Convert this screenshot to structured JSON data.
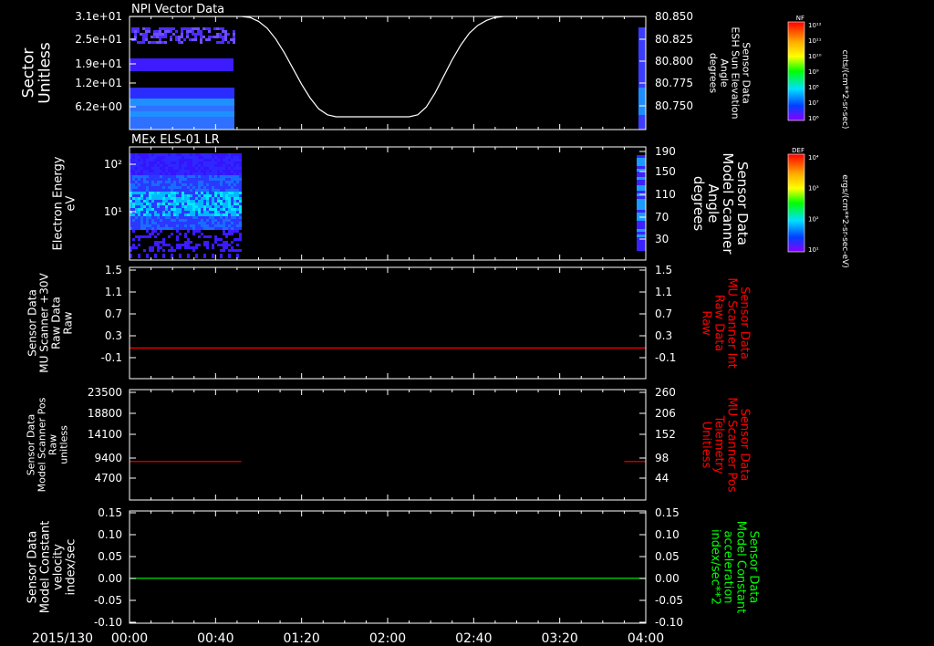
{
  "footer": {
    "date_label": "2015/130"
  },
  "x_ticks": [
    "00:00",
    "00:40",
    "01:20",
    "02:00",
    "02:40",
    "03:20",
    "04:00"
  ],
  "chart_data": [
    {
      "type": "heatmap",
      "title": "NPI Vector Data",
      "left_axis": {
        "labels": [
          "Sector",
          "Unitless"
        ],
        "ticks": [
          "3.1e+01",
          "2.5e+01",
          "1.9e+01",
          "1.2e+01",
          "6.2e+00"
        ]
      },
      "right_axis": {
        "labels": [
          "Sensor Data",
          "ESH Sun Elevation",
          "Angle",
          "degrees"
        ],
        "ticks": [
          "80.850",
          "80.825",
          "80.800",
          "80.775",
          "80.750"
        ],
        "ylim": [
          80.735,
          80.85
        ]
      },
      "line": {
        "color": "#ffffff",
        "x": [
          "00:00",
          "00:52",
          "00:56",
          "01:00",
          "01:04",
          "01:08",
          "01:12",
          "01:16",
          "01:20",
          "01:24",
          "01:28",
          "01:32",
          "01:36",
          "01:40",
          "01:44",
          "02:10",
          "02:14",
          "02:18",
          "02:22",
          "02:26",
          "02:30",
          "02:34",
          "02:38",
          "02:42",
          "02:46",
          "02:50",
          "02:54",
          "03:00",
          "04:00"
        ],
        "y": [
          80.85,
          80.85,
          80.849,
          80.845,
          80.838,
          80.827,
          80.813,
          80.797,
          80.781,
          80.767,
          80.756,
          80.75,
          80.748,
          80.748,
          80.748,
          80.748,
          80.75,
          80.758,
          80.772,
          80.789,
          80.806,
          80.821,
          80.833,
          80.841,
          80.846,
          80.849,
          80.85,
          80.85,
          80.85
        ]
      },
      "colorbar": {
        "label": "NF",
        "units": "cnts/(cm**2-sr-sec)",
        "ticks": [
          "10¹²",
          "10¹¹",
          "10¹⁰",
          "10⁹",
          "10⁸",
          "10⁷",
          "10⁶"
        ]
      }
    },
    {
      "type": "heatmap",
      "title": "MEx ELS-01 LR",
      "left_axis": {
        "labels": [
          "Electron Energy",
          "eV"
        ],
        "ticks": [
          "10²",
          "10¹"
        ]
      },
      "right_axis": {
        "labels": [
          "Sensor Data",
          "Model Scanner",
          "Angle",
          "degrees"
        ],
        "ticks": [
          "190",
          "150",
          "110",
          "70",
          "30"
        ],
        "ylim": [
          10,
          190
        ]
      },
      "colorbar": {
        "label": "DEF",
        "units": "ergs/(cm**2-sr-sec-eV)",
        "ticks": [
          "10⁴",
          "10³",
          "10²",
          "10¹"
        ]
      }
    },
    {
      "type": "line",
      "left_axis": {
        "labels": [
          "Sensor Data",
          "MU Scanner +30V",
          "Raw Data",
          "Raw"
        ],
        "ticks": [
          "1.5",
          "1.1",
          "0.7",
          "0.3",
          "-0.1"
        ],
        "ylim": [
          -0.5,
          1.5
        ]
      },
      "right_axis": {
        "labels": [
          "Sensor Data",
          "MU Scanner Int",
          "Raw Data",
          "Raw"
        ],
        "ticks": [
          "1.5",
          "1.1",
          "0.7",
          "0.3",
          "-0.1"
        ],
        "ylim": [
          -0.5,
          1.5
        ]
      },
      "series": [
        {
          "color": "#ff0000",
          "x": [
            "00:00",
            "04:00"
          ],
          "y": [
            0.05,
            0.05
          ]
        }
      ]
    },
    {
      "type": "line",
      "left_axis": {
        "labels": [
          "Sensor Data",
          "Model Scanner Pos",
          "Raw",
          "unitless"
        ],
        "ticks": [
          "23500",
          "18800",
          "14100",
          "9400",
          "4700"
        ],
        "ylim": [
          0,
          23500
        ]
      },
      "right_axis": {
        "labels": [
          "Sensor Data",
          "MU Scanner Pos",
          "Telemetry",
          "Unitless"
        ],
        "ticks": [
          "260",
          "206",
          "152",
          "98",
          "44"
        ],
        "ylim": [
          -10,
          260
        ]
      },
      "series": [
        {
          "color": "#ff0000",
          "x": [
            "00:00",
            "00:52"
          ],
          "y": [
            8200,
            8200
          ]
        },
        {
          "color": "#ff0000",
          "x": [
            "03:50",
            "04:00"
          ],
          "y": [
            8200,
            8200
          ]
        }
      ]
    },
    {
      "type": "line",
      "left_axis": {
        "labels": [
          "Sensor Data",
          "Model Constant",
          "velocity",
          "index/sec"
        ],
        "ticks": [
          "0.15",
          "0.10",
          "0.05",
          "0.00",
          "-0.05",
          "-0.10"
        ],
        "ylim": [
          -0.1,
          0.15
        ]
      },
      "right_axis": {
        "labels": [
          "Sensor Data",
          "Model Constant",
          "acceleration",
          "index/sec**2"
        ],
        "ticks": [
          "0.15",
          "0.10",
          "0.05",
          "0.00",
          "-0.05",
          "-0.10"
        ],
        "ylim": [
          -0.1,
          0.15
        ]
      },
      "series": [
        {
          "color": "#00ff00",
          "x": [
            "00:00",
            "04:00"
          ],
          "y": [
            0.0,
            0.0
          ]
        }
      ]
    }
  ]
}
